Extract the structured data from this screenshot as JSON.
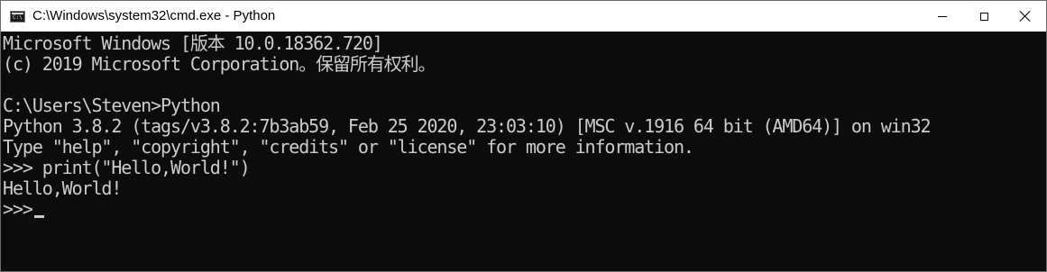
{
  "window": {
    "title": "C:\\Windows\\system32\\cmd.exe - Python",
    "icon_name": "cmd-app-icon",
    "icon_glyph": "C:\\"
  },
  "console": {
    "lines": [
      "Microsoft Windows [版本 10.0.18362.720]",
      "(c) 2019 Microsoft Corporation。保留所有权利。",
      "",
      "C:\\Users\\Steven>Python",
      "Python 3.8.2 (tags/v3.8.2:7b3ab59, Feb 25 2020, 23:03:10) [MSC v.1916 64 bit (AMD64)] on win32",
      "Type \"help\", \"copyright\", \"credits\" or \"license\" for more information.",
      ">>> print(\"Hello,World!\")",
      "Hello,World!"
    ],
    "prompt": ">>>"
  },
  "colors": {
    "console_background": "#0c0c0c",
    "console_text": "#cccccc",
    "titlebar_background": "#ffffff"
  }
}
